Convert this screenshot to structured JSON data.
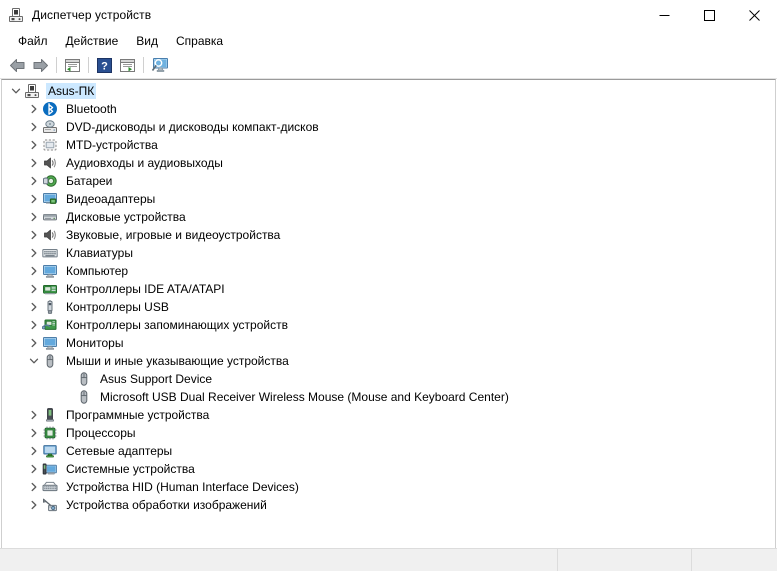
{
  "window": {
    "title": "Диспетчер устройств",
    "title_icon": "computer-icon",
    "controls": {
      "minimize": "minimize-button",
      "maximize": "maximize-button",
      "close": "close-button"
    }
  },
  "menubar": {
    "items": [
      {
        "label": "Файл"
      },
      {
        "label": "Действие"
      },
      {
        "label": "Вид"
      },
      {
        "label": "Справка"
      }
    ]
  },
  "toolbar": {
    "buttons": [
      {
        "name": "back-arrow-icon",
        "title": "Назад"
      },
      {
        "name": "forward-arrow-icon",
        "title": "Вперёд"
      },
      {
        "name": "properties-icon",
        "title": "Свойства"
      },
      {
        "name": "help-icon",
        "title": "Справка"
      },
      {
        "name": "update-driver-icon",
        "title": "Обновить конфигурацию оборудования"
      },
      {
        "name": "scan-hardware-icon",
        "title": "Показать скрытые устройства"
      }
    ]
  },
  "tree": {
    "root": {
      "label": "Asus-ПК",
      "icon": "computer-icon",
      "expanded": true,
      "selected": true
    },
    "items": [
      {
        "label": "Bluetooth",
        "icon": "bluetooth-icon",
        "level": 1,
        "expandable": true,
        "expanded": false
      },
      {
        "label": "DVD-дисководы и дисководы компакт-дисков",
        "icon": "dvd-drive-icon",
        "level": 1,
        "expandable": true,
        "expanded": false
      },
      {
        "label": "MTD-устройства",
        "icon": "mtd-device-icon",
        "level": 1,
        "expandable": true,
        "expanded": false
      },
      {
        "label": "Аудиовходы и аудиовыходы",
        "icon": "speaker-icon",
        "level": 1,
        "expandable": true,
        "expanded": false
      },
      {
        "label": "Батареи",
        "icon": "battery-icon",
        "level": 1,
        "expandable": true,
        "expanded": false
      },
      {
        "label": "Видеоадаптеры",
        "icon": "display-adapter-icon",
        "level": 1,
        "expandable": true,
        "expanded": false
      },
      {
        "label": "Дисковые устройства",
        "icon": "disk-drive-icon",
        "level": 1,
        "expandable": true,
        "expanded": false
      },
      {
        "label": "Звуковые, игровые и видеоустройства",
        "icon": "speaker-icon",
        "level": 1,
        "expandable": true,
        "expanded": false
      },
      {
        "label": "Клавиатуры",
        "icon": "keyboard-icon",
        "level": 1,
        "expandable": true,
        "expanded": false
      },
      {
        "label": "Компьютер",
        "icon": "monitor-icon",
        "level": 1,
        "expandable": true,
        "expanded": false
      },
      {
        "label": "Контроллеры IDE ATA/ATAPI",
        "icon": "ide-controller-icon",
        "level": 1,
        "expandable": true,
        "expanded": false
      },
      {
        "label": "Контроллеры USB",
        "icon": "usb-icon",
        "level": 1,
        "expandable": true,
        "expanded": false
      },
      {
        "label": "Контроллеры запоминающих устройств",
        "icon": "storage-controller-icon",
        "level": 1,
        "expandable": true,
        "expanded": false
      },
      {
        "label": "Мониторы",
        "icon": "monitor-icon",
        "level": 1,
        "expandable": true,
        "expanded": false
      },
      {
        "label": "Мыши и иные указывающие устройства",
        "icon": "mouse-icon",
        "level": 1,
        "expandable": true,
        "expanded": true
      },
      {
        "label": "Asus Support Device",
        "icon": "mouse-icon",
        "level": 2,
        "expandable": false,
        "expanded": false
      },
      {
        "label": "Microsoft USB Dual Receiver Wireless Mouse (Mouse and Keyboard Center)",
        "icon": "mouse-icon",
        "level": 2,
        "expandable": false,
        "expanded": false
      },
      {
        "label": "Программные устройства",
        "icon": "software-device-icon",
        "level": 1,
        "expandable": true,
        "expanded": false
      },
      {
        "label": "Процессоры",
        "icon": "processor-icon",
        "level": 1,
        "expandable": true,
        "expanded": false
      },
      {
        "label": "Сетевые адаптеры",
        "icon": "network-adapter-icon",
        "level": 1,
        "expandable": true,
        "expanded": false
      },
      {
        "label": "Системные устройства",
        "icon": "system-device-icon",
        "level": 1,
        "expandable": true,
        "expanded": false
      },
      {
        "label": "Устройства HID (Human Interface Devices)",
        "icon": "hid-device-icon",
        "level": 1,
        "expandable": true,
        "expanded": false
      },
      {
        "label": "Устройства обработки изображений",
        "icon": "imaging-device-icon",
        "level": 1,
        "expandable": true,
        "expanded": false
      }
    ]
  },
  "statusbar": {
    "pane1": "",
    "pane2": "",
    "pane3": ""
  },
  "colors": {
    "selection": "#cce8ff",
    "accent_blue": "#1a77c9",
    "bluetooth_blue": "#0a6cbf",
    "chrome": "#ffffff",
    "status_bg": "#f0f0f0",
    "close_hover": "#e81123"
  }
}
